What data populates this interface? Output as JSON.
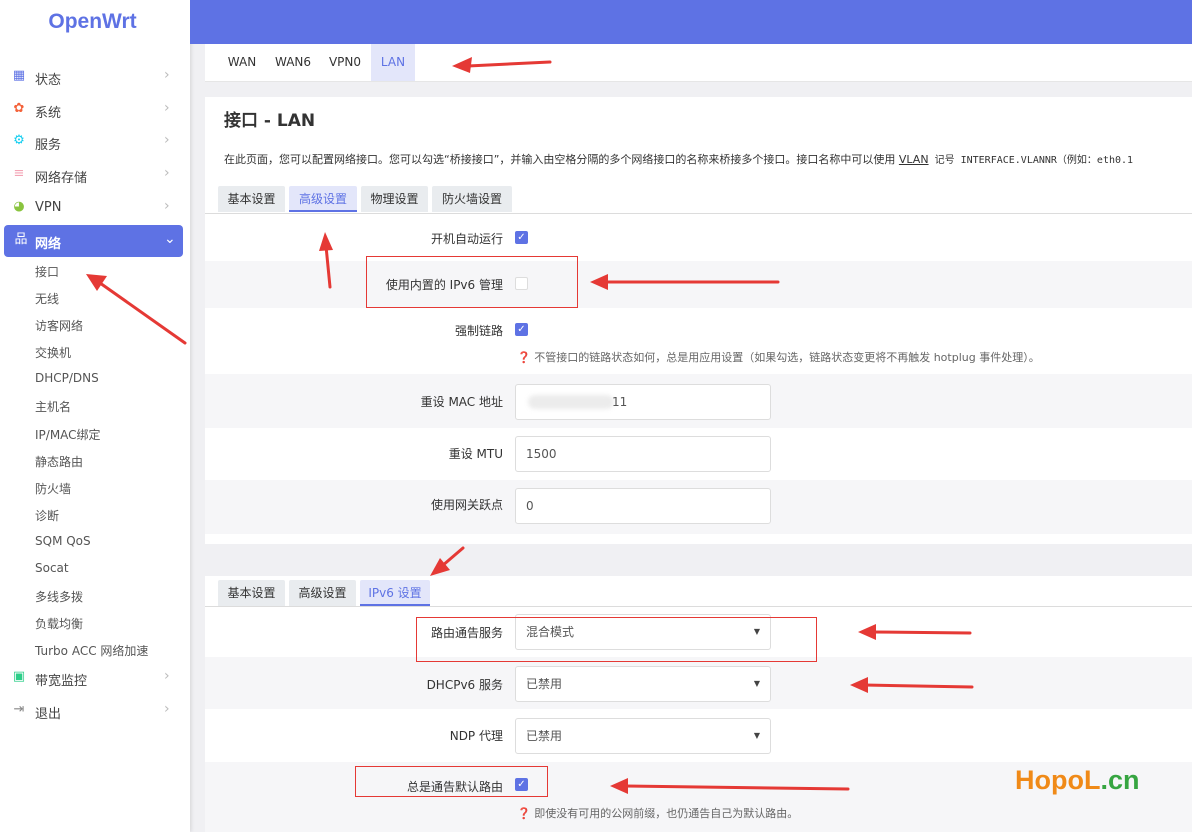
{
  "brand": {
    "logo": "OpenWrt",
    "accent": "#5e72e4"
  },
  "sidebar": {
    "items": [
      {
        "label": "状态",
        "icon": "dashboard-icon"
      },
      {
        "label": "系统",
        "icon": "gear-icon"
      },
      {
        "label": "服务",
        "icon": "cogs-icon"
      },
      {
        "label": "网络存储",
        "icon": "database-icon"
      },
      {
        "label": "VPN",
        "icon": "vpn-icon"
      },
      {
        "label": "网络",
        "icon": "sitemap-icon"
      },
      {
        "label": "带宽监控",
        "icon": "monitor-icon"
      },
      {
        "label": "退出",
        "icon": "logout-icon"
      }
    ],
    "network_subitems": [
      "接口",
      "无线",
      "访客网络",
      "交换机",
      "DHCP/DNS",
      "主机名",
      "IP/MAC绑定",
      "静态路由",
      "防火墙",
      "诊断",
      "SQM QoS",
      "Socat",
      "多线多拨",
      "负载均衡",
      "Turbo ACC 网络加速"
    ]
  },
  "top_tabs": [
    "WAN",
    "WAN6",
    "VPN0",
    "LAN"
  ],
  "page": {
    "title": "接口 - LAN",
    "description_pre": "在此页面，您可以配置网络接口。您可以勾选“桥接接口”，并输入由空格分隔的多个网络接口的名称来桥接多个接口。接口名称中可以使用 ",
    "description_link": "VLAN",
    "description_post": " 记号 INTERFACE.VLANNR（例如：eth0.1"
  },
  "section1": {
    "tabs": [
      "基本设置",
      "高级设置",
      "物理设置",
      "防火墙设置"
    ],
    "fields": {
      "autostart_label": "开机自动运行",
      "ipv6_label": "使用内置的 IPv6 管理",
      "force_link_label": "强制链路",
      "force_link_hint": "不管接口的链路状态如何，总是用应用设置（如果勾选，链路状态变更将不再触发 hotplug 事件处理）。",
      "mac_label": "重设 MAC 地址",
      "mac_value": "11",
      "mtu_label": "重设 MTU",
      "mtu_value": "1500",
      "metric_label": "使用网关跃点",
      "metric_value": "0"
    },
    "checks": {
      "autostart": true,
      "ipv6": false,
      "force_link": true
    }
  },
  "section2": {
    "tabs": [
      "基本设置",
      "高级设置",
      "IPv6 设置"
    ],
    "fields": {
      "ra_label": "路由通告服务",
      "ra_value": "混合模式",
      "dhcpv6_label": "DHCPv6 服务",
      "dhcpv6_value": "已禁用",
      "ndp_label": "NDP 代理",
      "ndp_value": "已禁用",
      "default_route_label": "总是通告默认路由",
      "default_route_hint": "即使没有可用的公网前缀，也仍通告自己为默认路由。"
    },
    "checks": {
      "default_route": true
    }
  },
  "watermark": {
    "main": "HopoL",
    "suffix": ".cn"
  }
}
